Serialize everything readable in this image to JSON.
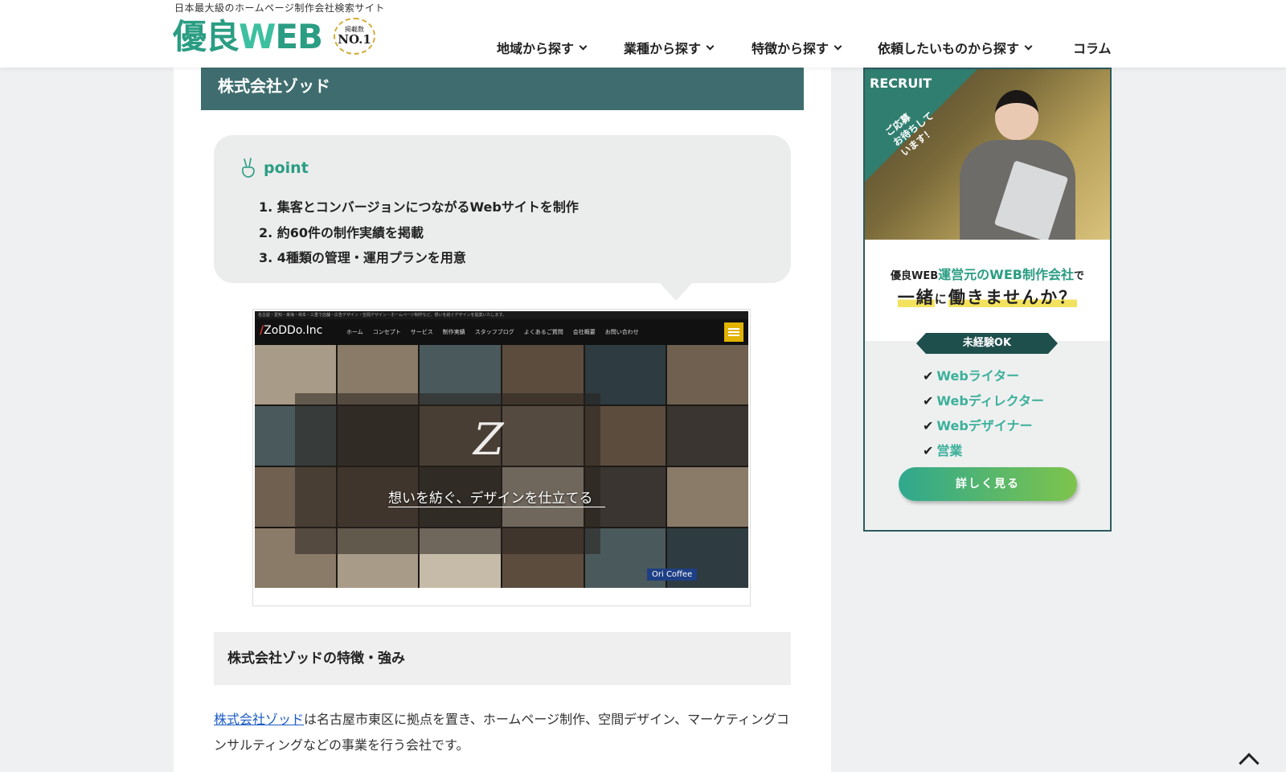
{
  "header": {
    "tagline": "日本最大級のホームページ制作会社検索サイト",
    "logo_main": "優良",
    "logo_w": "W",
    "logo_eb": "EB",
    "badge_top": "掲載数",
    "badge_no": "NO.1",
    "nav": [
      {
        "label": "地域から探す",
        "has_dropdown": true
      },
      {
        "label": "業種から探す",
        "has_dropdown": true
      },
      {
        "label": "特徴から探す",
        "has_dropdown": true
      },
      {
        "label": "依頼したいものから探す",
        "has_dropdown": true
      },
      {
        "label": "コラム",
        "has_dropdown": false
      }
    ]
  },
  "article": {
    "title": "株式会社ゾッド",
    "point": {
      "heading": "point",
      "items": [
        "1. 集客とコンバージョンにつながるWebサイトを制作",
        "2. 約60件の制作実績を掲載",
        "3. 4種類の管理・運用プランを用意"
      ]
    },
    "screenshot": {
      "topline": "名古屋・愛知・東海・岐阜・三重で店舗・広告デザイン・空間デザイン・ホームページ制作など、想いを紡ぐデザインを提案いたします。",
      "logo": "ZoDDo.Inc",
      "menu": [
        "ホーム",
        "コンセプト",
        "サービス",
        "制作実績",
        "スタッフブログ",
        "よくあるご質問",
        "会社概要",
        "お問い合わせ"
      ],
      "tagline": "想いを紡ぐ、デザインを仕立てる",
      "sign": "Ori Coffee"
    },
    "section_heading": "株式会社ゾッドの特徴・強み",
    "body_link": "株式会社ゾッド",
    "body_text": "は名古屋市東区に拠点を置き、ホームページ制作、空間デザイン、マーケティングコンサルティングなどの事業を行う会社です。"
  },
  "banner": {
    "label": "RECRUIT",
    "message_line1": "ご応募",
    "message_line2": "お待ちして",
    "message_line3": "います！",
    "sub_prefix": "優良WEB",
    "sub_highlight": "運営元のWEB制作会社",
    "sub_suffix": "で",
    "main_part1": "一緒",
    "main_part2": "に",
    "main_part3": "働き",
    "main_part4": "ませんか？",
    "ribbon": "未経験OK",
    "jobs": [
      "Webライター",
      "Webディレクター",
      "Webデザイナー",
      "営業"
    ],
    "cta": "詳しく見る"
  },
  "colors": {
    "brand_teal": "#2a9d83",
    "title_bar": "#3f6d6f",
    "link_blue": "#1a5bc4"
  }
}
